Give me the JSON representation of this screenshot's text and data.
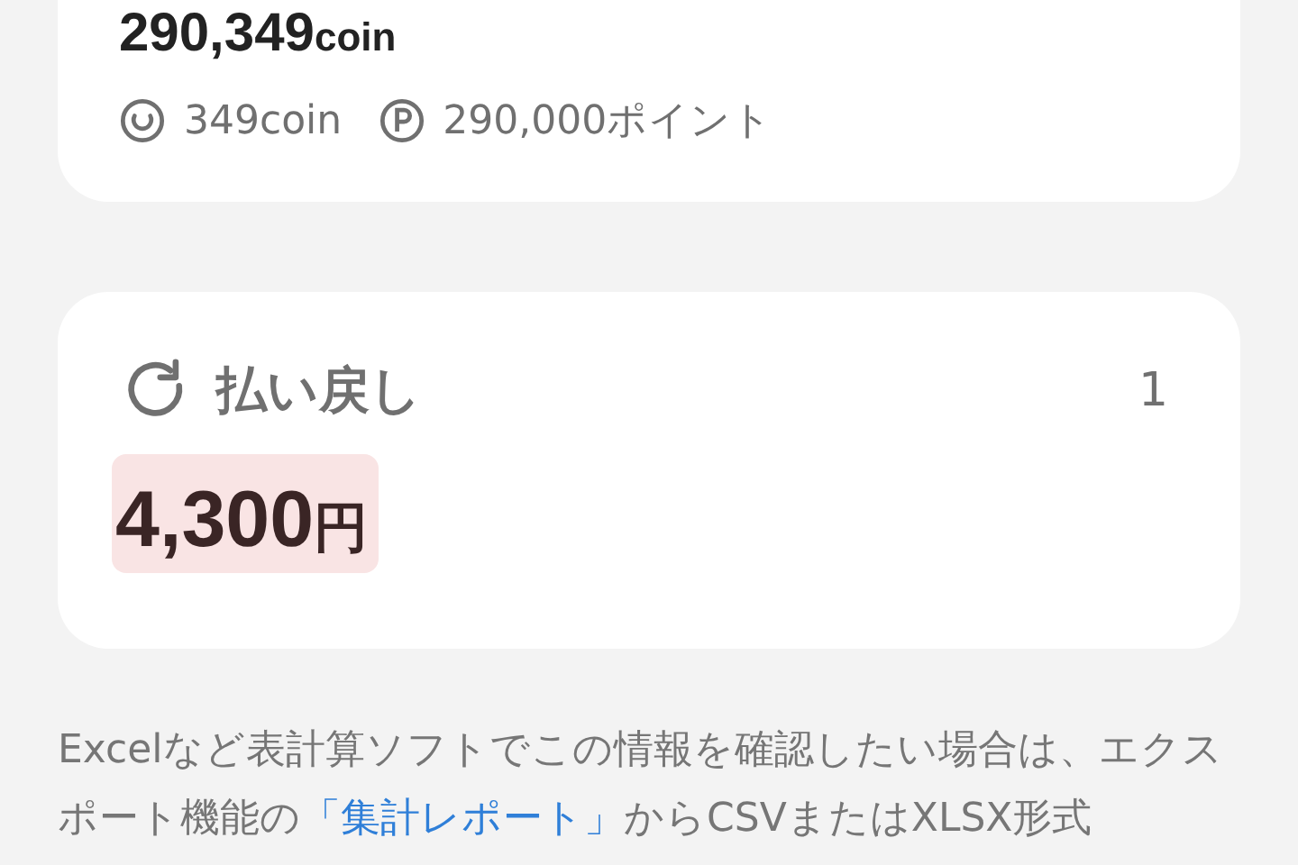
{
  "balance": {
    "total": "290,349",
    "total_unit": "coin",
    "coins": "349coin",
    "points": "290,000ポイント"
  },
  "refund": {
    "title": "払い戻し",
    "count": "1",
    "amount": "4,300",
    "unit": "円"
  },
  "notice": {
    "before": "Excelなど表計算ソフトでこの情報を確認したい場合は、エクスポート機能の",
    "link": "「集計レポート」",
    "after": "からCSVまたはXLSX形式"
  }
}
